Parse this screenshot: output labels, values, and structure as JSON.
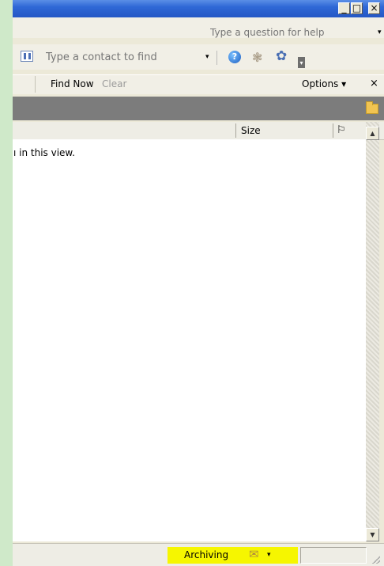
{
  "window": {
    "minimize_icon": "minimize-icon",
    "restore_icon": "restore-icon",
    "close_icon": "close-icon",
    "minimize_glyph": "_",
    "restore_glyph": "□",
    "close_glyph": "×"
  },
  "menubar": {
    "help_placeholder": "Type a question for help",
    "help_arrow": "▾"
  },
  "toolbar": {
    "contact_placeholder": "Type a contact to find",
    "contact_dropdown_arrow": "▾",
    "icons": [
      "address-book-icon",
      "help-icon",
      "research-icon",
      "tools-icon"
    ],
    "overflow_glyph": "▾",
    "help_glyph": "?"
  },
  "find_bar": {
    "find_now": "Find Now",
    "clear": "Clear",
    "options": "Options ▾",
    "close": "×"
  },
  "columns": {
    "size": "Size",
    "flag_icon": "flag-icon",
    "flag_glyph": "⚐"
  },
  "content": {
    "empty_message": "ı in this view."
  },
  "scrollbar": {
    "up_glyph": "▲",
    "down_glyph": "▼"
  },
  "status": {
    "archiving": "Archiving",
    "archive_icon": "archive-icon",
    "archive_glyph": "✉",
    "archive_arrow": "▾"
  },
  "colors": {
    "titlebar": "#2457c5",
    "archiving_highlight": "#f6f600",
    "header_band": "#7c7c7c"
  }
}
